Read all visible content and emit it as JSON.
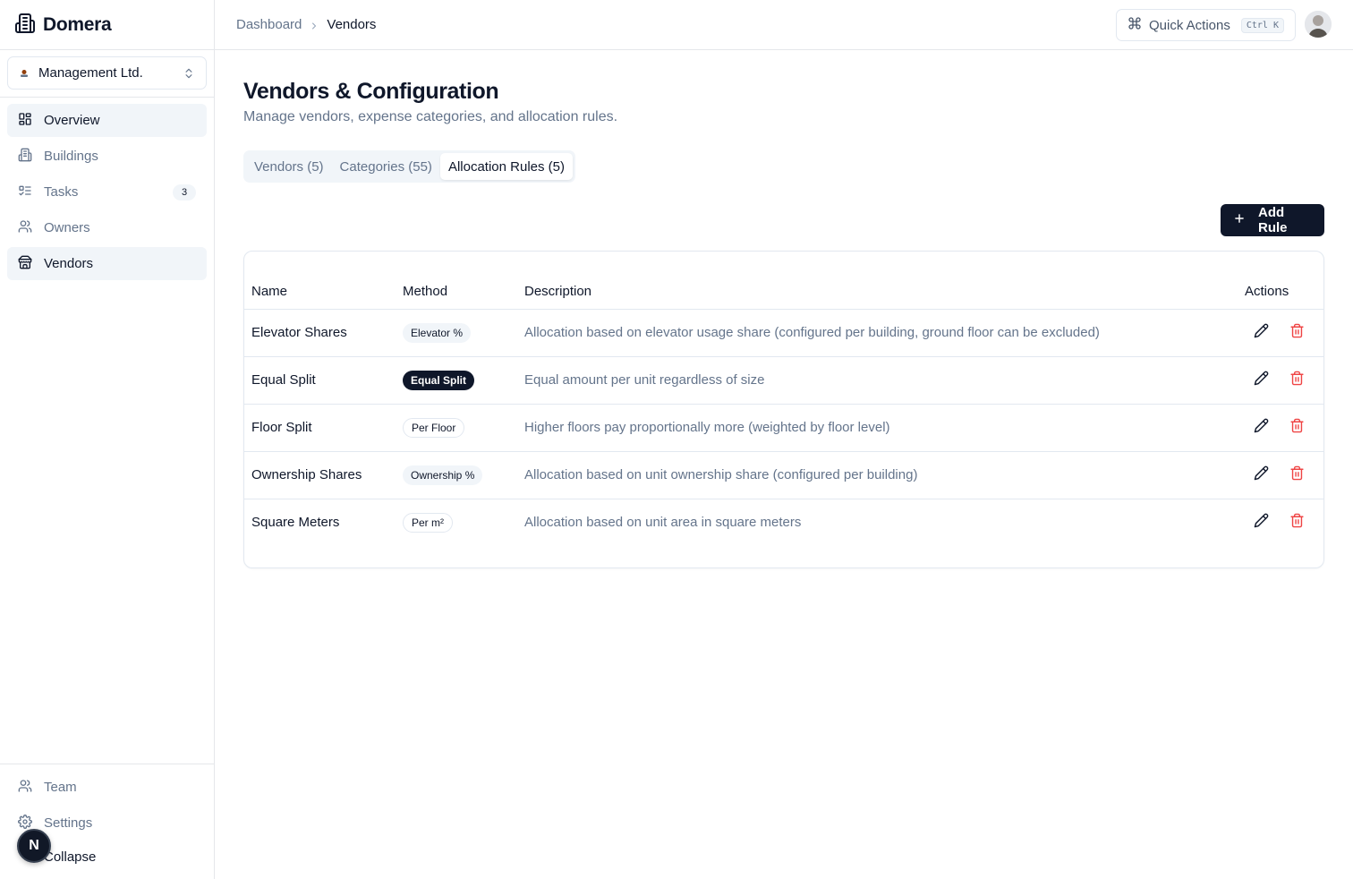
{
  "app": {
    "name": "Domera"
  },
  "org": {
    "name": "Management Ltd."
  },
  "nav": {
    "items": [
      {
        "label": "Overview",
        "icon": "grid-icon"
      },
      {
        "label": "Buildings",
        "icon": "building-icon"
      },
      {
        "label": "Tasks",
        "icon": "list-check-icon",
        "badge": "3"
      },
      {
        "label": "Owners",
        "icon": "users-icon"
      },
      {
        "label": "Vendors",
        "icon": "store-icon"
      }
    ],
    "bottom": [
      {
        "label": "Team",
        "icon": "users-icon"
      },
      {
        "label": "Settings",
        "icon": "gear-icon"
      }
    ],
    "collapse_label": "Collapse",
    "dev_badge": "N"
  },
  "header": {
    "breadcrumb": {
      "parent": "Dashboard",
      "current": "Vendors"
    },
    "quick_actions": {
      "label": "Quick Actions",
      "shortcut": "Ctrl K"
    }
  },
  "page": {
    "title": "Vendors & Configuration",
    "subtitle": "Manage vendors, expense categories, and allocation rules."
  },
  "tabs": [
    {
      "label": "Vendors (5)",
      "active": false
    },
    {
      "label": "Categories (55)",
      "active": false
    },
    {
      "label": "Allocation Rules (5)",
      "active": true
    }
  ],
  "add_button": {
    "label": "Add Rule"
  },
  "table": {
    "columns": [
      "Name",
      "Method",
      "Description",
      "Actions"
    ],
    "rows": [
      {
        "name": "Elevator Shares",
        "method": "Elevator %",
        "method_style": "secondary",
        "description": "Allocation based on elevator usage share (configured per building, ground floor can be excluded)"
      },
      {
        "name": "Equal Split",
        "method": "Equal Split",
        "method_style": "dark",
        "description": "Equal amount per unit regardless of size"
      },
      {
        "name": "Floor Split",
        "method": "Per Floor",
        "method_style": "outline",
        "description": "Higher floors pay proportionally more (weighted by floor level)"
      },
      {
        "name": "Ownership Shares",
        "method": "Ownership %",
        "method_style": "secondary",
        "description": "Allocation based on unit ownership share (configured per building)"
      },
      {
        "name": "Square Meters",
        "method": "Per m²",
        "method_style": "outline",
        "description": "Allocation based on unit area in square meters"
      }
    ]
  },
  "colors": {
    "primary": "#0f172a",
    "muted": "#64748b",
    "danger": "#ef4444",
    "border": "#e2e8f0"
  }
}
